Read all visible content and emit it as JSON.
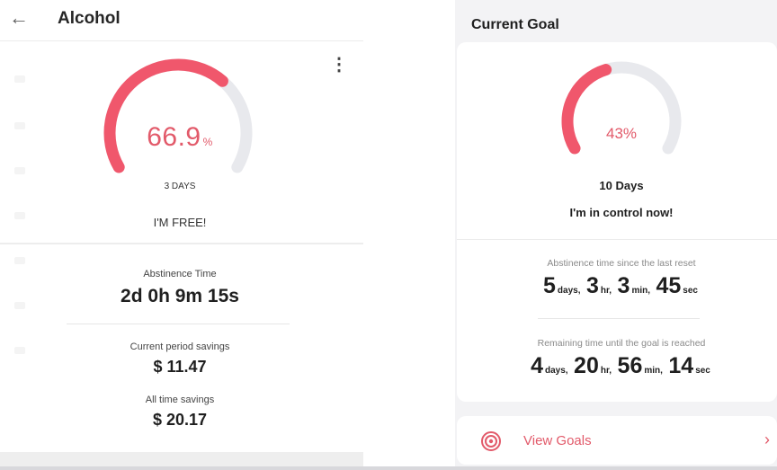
{
  "left": {
    "header": {
      "back_icon": "arrow-left-icon",
      "title": "Alcohol",
      "menu_icon": "more-vertical-icon"
    },
    "progress": {
      "percent": "66.9",
      "unit": "%",
      "days": "3 DAYS",
      "status": "I'M FREE!",
      "fraction": 0.669,
      "color": "#f0576c",
      "track_color": "#e8e9ed"
    },
    "abstinence": {
      "label": "Abstinence Time",
      "value": "2d 0h 9m 15s"
    },
    "current_savings": {
      "label": "Current period savings",
      "value": "$ 11.47"
    },
    "all_time_savings": {
      "label": "All time savings",
      "value": "$ 20.17"
    }
  },
  "right": {
    "section_title": "Current Goal",
    "progress": {
      "percent": "43%",
      "days": "10 Days",
      "status": "I'm in control now!",
      "fraction": 0.43,
      "color": "#f0576c",
      "track_color": "#e8e9ed"
    },
    "since_reset": {
      "label": "Abstinence time since the last reset",
      "days": "5",
      "days_unit": "days,",
      "hours": "3",
      "hours_unit": "hr,",
      "minutes": "3",
      "minutes_unit": "min,",
      "seconds": "45",
      "seconds_unit": "sec"
    },
    "remaining": {
      "label": "Remaining time until the goal is reached",
      "days": "4",
      "days_unit": "days,",
      "hours": "20",
      "hours_unit": "hr,",
      "minutes": "56",
      "minutes_unit": "min,",
      "seconds": "14",
      "seconds_unit": "sec"
    },
    "view_goals": {
      "label": "View Goals",
      "icon": "target-icon",
      "chevron": "›"
    }
  },
  "accent": "#e25a6a"
}
